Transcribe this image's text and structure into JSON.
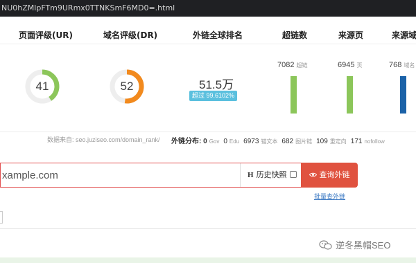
{
  "browser": {
    "url_fragment": "NU0hZMlpFTm9URmx0TTNKSmF6MD0=.html"
  },
  "table": {
    "headers": {
      "page_rating": "页面评级(UR)",
      "domain_rating": "域名评级(DR)",
      "global_rank": "外链全球排名",
      "backlinks": "超链数",
      "source_pages": "来源页",
      "source_domains": "来源域"
    },
    "page_rating": {
      "value": "41",
      "percent": 41,
      "color": "#8cc65a"
    },
    "domain_rating": {
      "value": "52",
      "percent": 52,
      "color": "#f28a1e"
    },
    "global_rank": {
      "value": "51.5万",
      "badge": "超过 99.6102%"
    },
    "backlinks": {
      "count": "7082",
      "unit": "超链",
      "color": "#8cc65a"
    },
    "source_pages": {
      "count": "6945",
      "unit": "页",
      "color": "#8cc65a"
    },
    "source_domains": {
      "count": "768",
      "unit": "域名",
      "color": "#1b62a8"
    }
  },
  "source": {
    "text": "数据来自: seo.juziseo.com/domain_rank/",
    "dist_label": "外链分布:",
    "gov_count": "0",
    "gov_label": "Gov",
    "edu_count": "0",
    "edu_label": "Edu",
    "text_count": "6973",
    "text_label": "锚文本",
    "img_count": "682",
    "img_label": "图片链",
    "redirect_count": "109",
    "redirect_label": "重定向",
    "nofollow_count": "171",
    "nofollow_label": "nofollow"
  },
  "search": {
    "value": "xample.com",
    "history_icon": "H",
    "history_label": "历史快照",
    "query_label": "查询外链",
    "batch_link": "批量查外链"
  },
  "watermark": {
    "text": "逆冬黑帽SEO",
    "icon": "wechat-icon"
  }
}
